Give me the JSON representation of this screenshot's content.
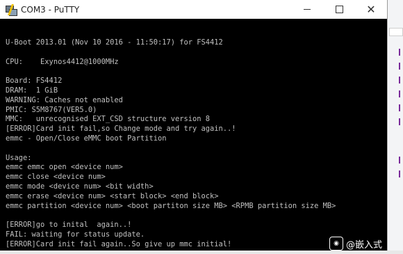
{
  "window": {
    "title": "COM3 - PuTTY",
    "close_glyph": "✕"
  },
  "terminal": {
    "lines": [
      "U-Boot 2013.01 (Nov 10 2016 - 11:50:17) for FS4412",
      "",
      "CPU:    Exynos4412@1000MHz",
      "",
      "Board: FS4412",
      "DRAM:  1 GiB",
      "WARNING: Caches not enabled",
      "PMIC: S5M8767(VER5.0)",
      "MMC:   unrecognised EXT_CSD structure version 8",
      "[ERROR]Card init fail,so Change mode and try again..!",
      "emmc - Open/Close eMMC boot Partition",
      "",
      "Usage:",
      "emmc emmc open <device num>",
      "emmc close <device num>",
      "emmc mode <device num> <bit width>",
      "emmc erase <device num> <start block> <end block>",
      "emmc partition <device num> <boot partiton size MB> <RPMB partition size MB>",
      "",
      "[ERROR]go to inital  again..!",
      "FAIL: waiting for status update.",
      "[ERROR]Card init fail again..So give up mmc initial!"
    ]
  },
  "watermark": {
    "icon": "wechat-icon",
    "text": "@嵌入式"
  },
  "colors": {
    "terminal_bg": "#000000",
    "terminal_fg": "#c0c0c0"
  }
}
